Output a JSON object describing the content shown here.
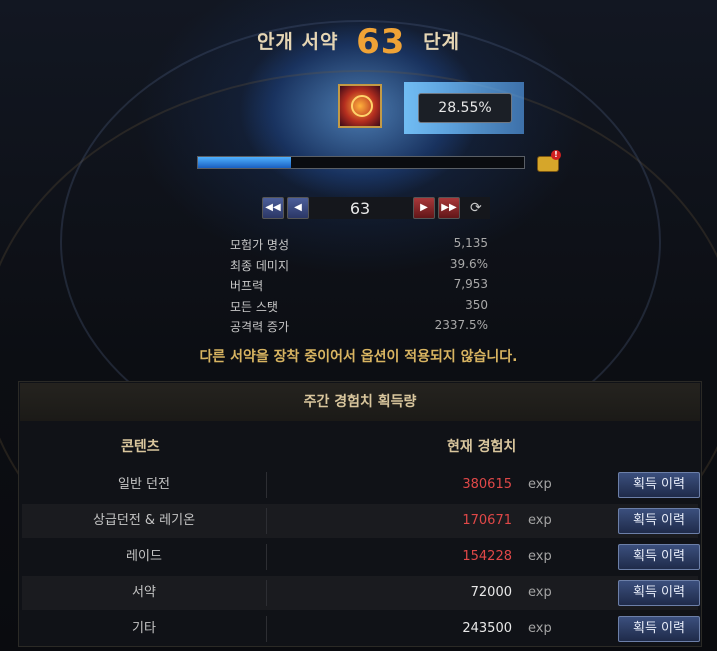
{
  "header": {
    "title_prefix": "안개 서약",
    "level": "63",
    "title_suffix": "단계"
  },
  "progress": {
    "percent_label": "28.55%",
    "fraction": 0.2855
  },
  "nav": {
    "level": "63",
    "first_icon": "rewind-icon",
    "prev_icon": "prev-icon",
    "next_icon": "next-icon",
    "last_icon": "fast-forward-icon"
  },
  "stats": [
    {
      "label": "모험가 명성",
      "value": "5,135"
    },
    {
      "label": "최종 데미지",
      "value": "39.6%"
    },
    {
      "label": "버프력",
      "value": "7,953"
    },
    {
      "label": "모든 스탯",
      "value": "350"
    },
    {
      "label": "공격력 증가",
      "value": "2337.5%"
    }
  ],
  "notice": "다른 서약을 장착 중이어서 옵션이 적용되지 않습니다.",
  "weekly": {
    "title": "주간 경험치 획득량",
    "col_content": "콘텐츠",
    "col_exp": "현재 경험치",
    "rows": [
      {
        "name": "일반 던전",
        "value": "380615",
        "unit": "exp",
        "button": "획득 이력",
        "color": "#e04848"
      },
      {
        "name": "상급던전 & 레기온",
        "value": "170671",
        "unit": "exp",
        "button": "획득 이력",
        "color": "#e04848"
      },
      {
        "name": "레이드",
        "value": "154228",
        "unit": "exp",
        "button": "획득 이력",
        "color": "#e04848"
      },
      {
        "name": "서약",
        "value": "72000",
        "unit": "exp",
        "button": "획득 이력",
        "color": "#e8e8e8"
      },
      {
        "name": "기타",
        "value": "243500",
        "unit": "exp",
        "button": "획득 이력",
        "color": "#e8e8e8"
      }
    ]
  }
}
